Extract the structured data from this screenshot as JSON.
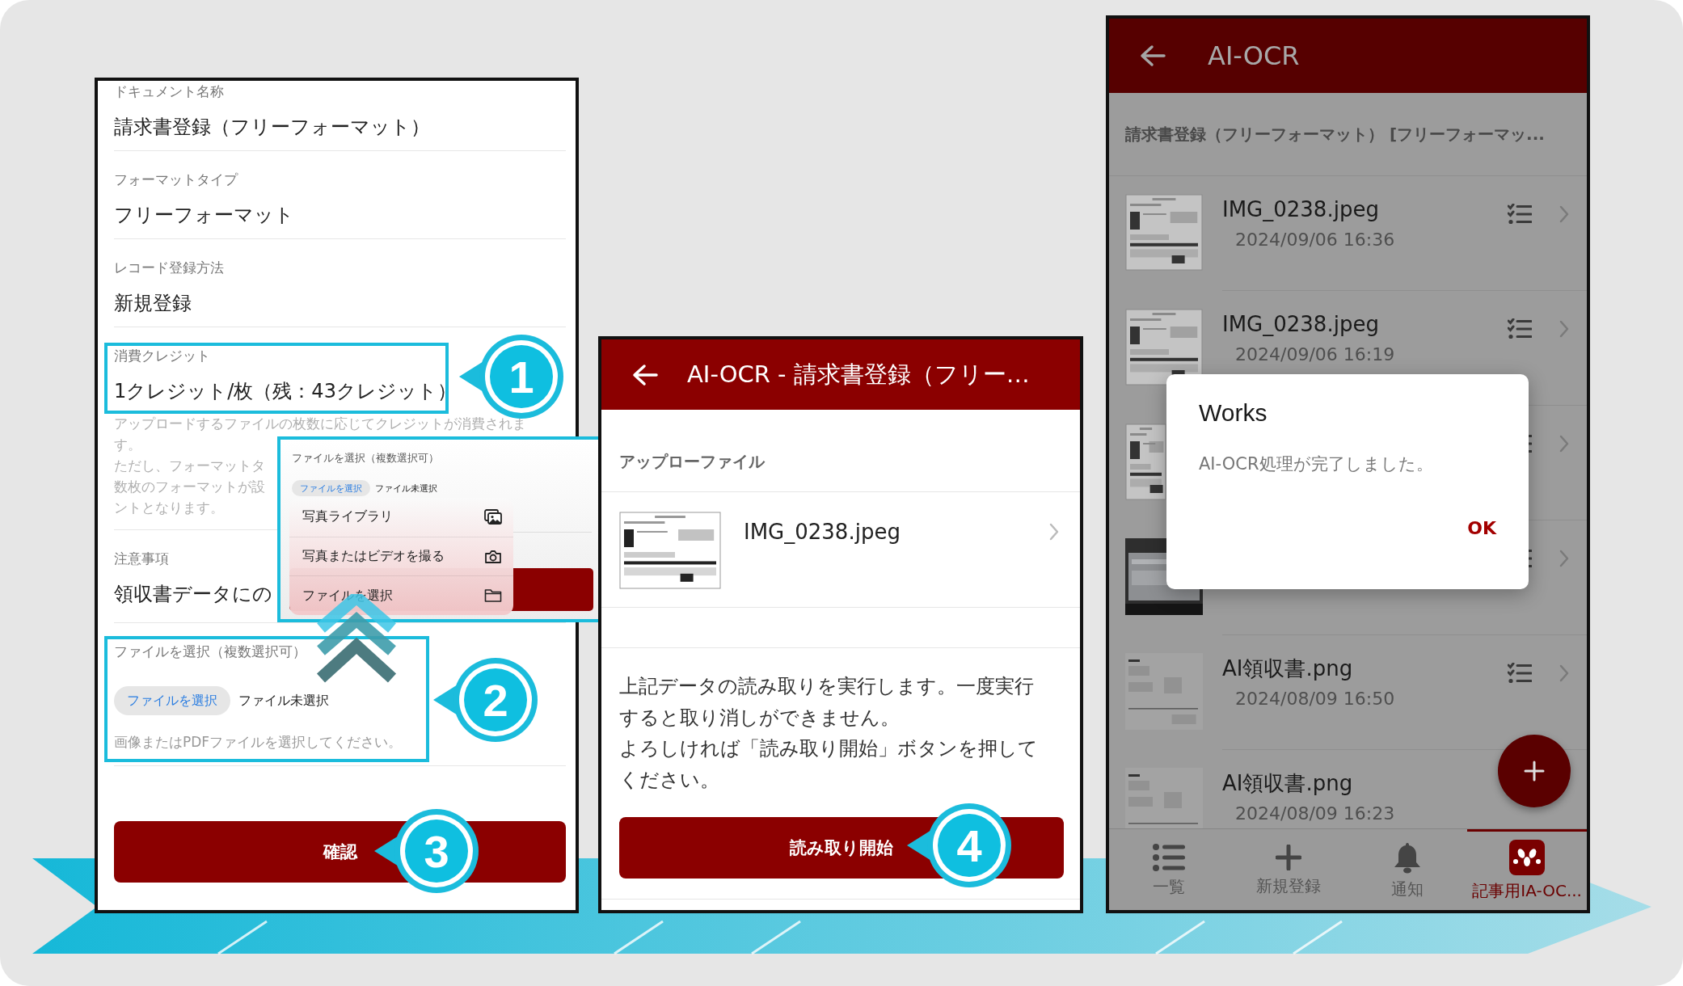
{
  "form_screen": {
    "fields": [
      {
        "label": "ドキュメント名称",
        "value": "請求書登録（フリーフォーマット）"
      },
      {
        "label": "フォーマットタイプ",
        "value": "フリーフォーマット"
      },
      {
        "label": "レコード登録方法",
        "value": "新規登録"
      },
      {
        "label": "消費クレジット",
        "value": "1クレジット/枚（残：43クレジット）"
      }
    ],
    "credit_note": [
      "アップロードするファイルの枚数に応じてクレジットが消費されま",
      "す。",
      "ただし、フォーマットタ",
      "数枚のフォーマットが設",
      "ントとなります。"
    ],
    "notice": {
      "label": "注意事項",
      "value": "領収書データにの"
    },
    "file_field": {
      "label": "ファイルを選択（複数選択可）",
      "button": "ファイルを選択",
      "status": "ファイル未選択",
      "hint": "画像またはPDFファイルを選択してください。"
    },
    "confirm_button": "確認"
  },
  "file_picker_popup": {
    "label": "ファイルを選択（複数選択可）",
    "button": "ファイルを選択",
    "status": "ファイル未選択",
    "menu": [
      {
        "label": "写真ライブラリ"
      },
      {
        "label": "写真またはビデオを撮る"
      },
      {
        "label": "ファイルを選択"
      }
    ]
  },
  "upload_screen": {
    "title": "AI-OCR - 請求書登録（フリー…",
    "section": "アップローファイル",
    "file": {
      "name": "IMG_0238.jpeg"
    },
    "message": [
      "上記データの読み取りを実行します。一度実行すると取り消しができません。",
      "よろしければ「読み取り開始」ボタンを押してください。"
    ],
    "button": "読み取り開始"
  },
  "list_screen": {
    "title": "AI-OCR",
    "subtitle": "請求書登録（フリーフォーマット） [フリーフォーマッ...",
    "files": [
      {
        "kind": "file",
        "name": "IMG_0238.jpeg",
        "date": "2024/09/06 16:36"
      },
      {
        "kind": "file",
        "name": "IMG_0238.jpeg",
        "date": "2024/09/06 16:19"
      },
      {
        "kind": "picture"
      },
      {
        "kind": "picture"
      },
      {
        "kind": "file",
        "name": "AI領収書.png",
        "date": "2024/08/09 16:50"
      },
      {
        "kind": "file",
        "name": "AI領収書.png",
        "date": "2024/08/09 16:23"
      }
    ],
    "dialog": {
      "title": "Works",
      "message": "AI-OCR処理が完了しました。",
      "ok": "OK"
    },
    "nav": [
      {
        "label": "一覧",
        "selected": false
      },
      {
        "label": "新規登録",
        "selected": false
      },
      {
        "label": "通知",
        "selected": false
      },
      {
        "label": "記事用IA-OC...",
        "selected": true
      }
    ]
  },
  "steps": [
    "1",
    "2",
    "3",
    "4"
  ]
}
